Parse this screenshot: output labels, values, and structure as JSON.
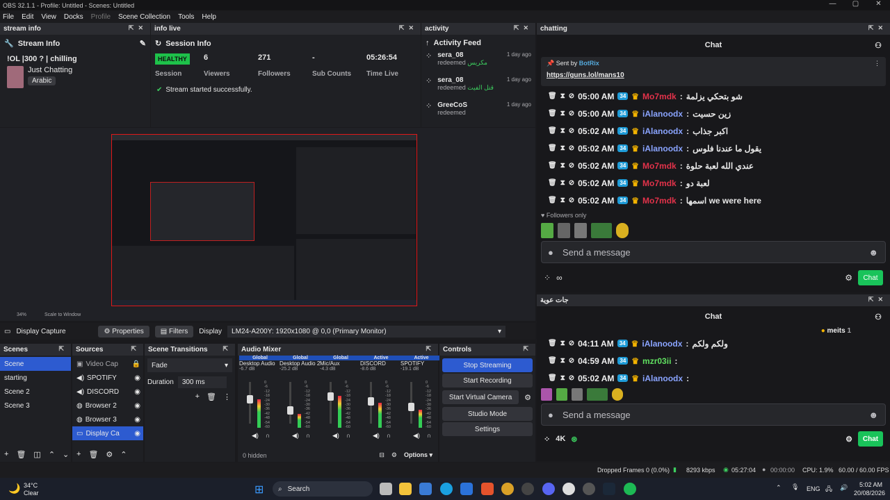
{
  "window": {
    "title": "OBS 32.1.1 - Profile: Untitled - Scenes: Untitled"
  },
  "menu": [
    "File",
    "Edit",
    "View",
    "Docks",
    "Profile",
    "Scene Collection",
    "Tools",
    "Help"
  ],
  "docks": {
    "stream_info": "stream info",
    "info_live": "info live",
    "activity": "activity",
    "chatting": "chatting",
    "chat2": "جات عوية"
  },
  "stream_info": {
    "heading": "Stream Info",
    "title": "!OL |300 ? | chilling",
    "category": "Just Chatting",
    "language": "Arabic"
  },
  "session": {
    "heading": "Session Info",
    "health": "HEALTHY",
    "health_label": "Session",
    "stats": [
      {
        "value": "6",
        "label": "Viewers"
      },
      {
        "value": "271",
        "label": "Followers"
      },
      {
        "value": "-",
        "label": "Sub Counts"
      },
      {
        "value": "05:26:54",
        "label": "Time Live"
      }
    ],
    "notice": "Stream started successfully."
  },
  "activity": {
    "heading": "Activity Feed",
    "items": [
      {
        "name": "sera_08",
        "action": "redeemed",
        "reward": "مكريس",
        "time": "1 day ago"
      },
      {
        "name": "sera_08",
        "action": "redeemed",
        "reward": "قتل الفيت",
        "time": "1 day ago"
      },
      {
        "name": "GreeCoS",
        "action": "redeemed",
        "reward": "",
        "time": "1 day ago"
      }
    ]
  },
  "preview": {
    "zoom": "34%",
    "scale_label": "Scale to Window"
  },
  "source_bar": {
    "source": "Display Capture",
    "properties": "Properties",
    "filters": "Filters",
    "display_label": "Display",
    "display_value": "LM24-A200Y: 1920x1080 @ 0,0 (Primary Monitor)"
  },
  "scenes": {
    "title": "Scenes",
    "items": [
      "Scene",
      "starting",
      "Scene 2",
      "Scene 3"
    ]
  },
  "sources": {
    "title": "Sources",
    "items": [
      "Video Cap",
      "SPOTIFY",
      "DISCORD",
      "Browser 2",
      "Browser 3",
      "Display Ca"
    ]
  },
  "transitions": {
    "title": "Scene Transitions",
    "type": "Fade",
    "duration_label": "Duration",
    "duration": "300 ms"
  },
  "mixer": {
    "title": "Audio Mixer",
    "hidden": "0 hidden",
    "options": "Options",
    "channels": [
      {
        "tag": "Global",
        "name": "Desktop Audio",
        "db": "-6.7 dB",
        "level": 0.62
      },
      {
        "tag": "Global",
        "name": "Desktop Audio 2",
        "db": "-25.2 dB",
        "level": 0.3
      },
      {
        "tag": "Global",
        "name": "Mic/Aux",
        "db": "-4.3 dB",
        "level": 0.7
      },
      {
        "tag": "Active",
        "name": "DISCORD",
        "db": "-8.6 dB",
        "level": 0.55
      },
      {
        "tag": "Active",
        "name": "SPOTIFY",
        "db": "-19.1 dB",
        "level": 0.4
      }
    ],
    "scale": [
      "0",
      "-6",
      "-12",
      "-18",
      "-24",
      "-30",
      "-36",
      "-42",
      "-48",
      "-54",
      "-60"
    ]
  },
  "controls": {
    "title": "Controls",
    "buttons": [
      "Stop Streaming",
      "Start Recording",
      "Start Virtual Camera",
      "Studio Mode",
      "Settings"
    ]
  },
  "chat1": {
    "title": "Chat",
    "pinned_from": "Sent by",
    "pinned_user": "BotRix",
    "pinned_link": "https://guns.lol/mans10",
    "messages": [
      {
        "time": "05:00 AM",
        "user": "Mo7mdk",
        "msg": "شو بتحكي يزلمة",
        "color": "red"
      },
      {
        "time": "05:00 AM",
        "user": "iAlanoodx",
        "msg": "زين حسيت",
        "color": "blue"
      },
      {
        "time": "05:02 AM",
        "user": "iAlanoodx",
        "msg": "اكبر جذاب",
        "color": "blue"
      },
      {
        "time": "05:02 AM",
        "user": "iAlanoodx",
        "msg": "يقول ما عندنا فلوس",
        "color": "blue"
      },
      {
        "time": "05:02 AM",
        "user": "Mo7mdk",
        "msg": "عندي الله لعبة حلوة",
        "color": "red"
      },
      {
        "time": "05:02 AM",
        "user": "Mo7mdk",
        "msg": "لعبة دو",
        "color": "red"
      },
      {
        "time": "05:02 AM",
        "user": "Mo7mdk",
        "msg": "اسمها we were here",
        "color": "red"
      }
    ],
    "followers_only": "Followers only",
    "placeholder": "Send a message",
    "viewer_count": "∞",
    "chat_button": "Chat"
  },
  "chat2": {
    "title": "Chat",
    "meits": "meits",
    "meits_count": "1",
    "messages": [
      {
        "time": "04:11 AM",
        "user": "iAlanoodx",
        "msg": "ولكم ولكم",
        "color": "blue"
      },
      {
        "time": "04:59 AM",
        "user": "mzr03ii",
        "msg": "",
        "color": "green"
      },
      {
        "time": "05:02 AM",
        "user": "iAlanoodx",
        "msg": "",
        "color": "blue"
      }
    ],
    "placeholder": "Send a message",
    "viewer_count": "4K",
    "chat_button": "Chat"
  },
  "status": {
    "dropped": "Dropped Frames 0 (0.0%)",
    "kbps": "8293 kbps",
    "live_time": "05:27:04",
    "rec_time": "00:00:00",
    "cpu": "CPU: 1.9%",
    "fps": "60.00 / 60.00 FPS"
  },
  "taskbar": {
    "weather_temp": "34°C",
    "weather_desc": "Clear",
    "search": "Search",
    "lang": "ENG",
    "time": "5:02 AM",
    "date": "20/08/2026"
  }
}
